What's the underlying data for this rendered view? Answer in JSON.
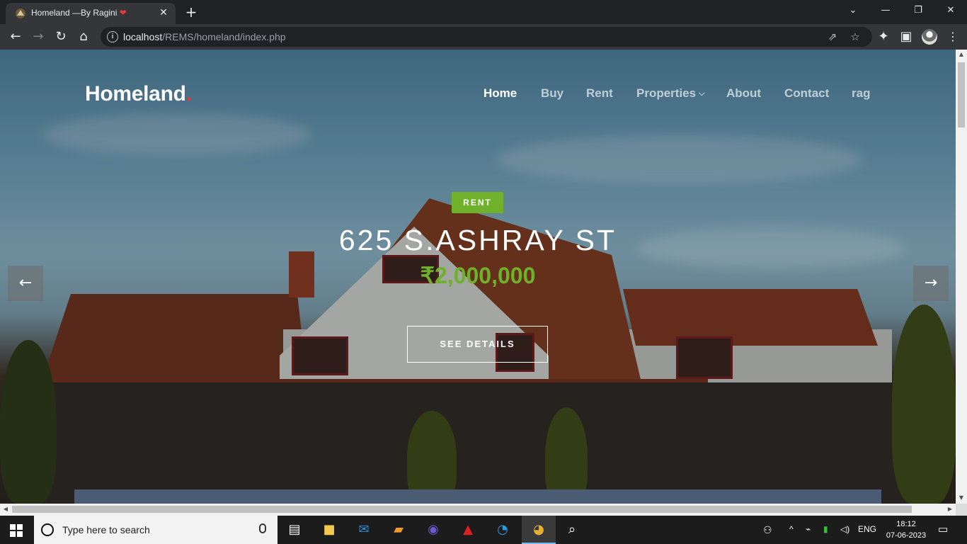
{
  "browser": {
    "tab_title": "Homeland —By Ragini",
    "tab_heart": "❤",
    "tab_close": "✕",
    "new_tab": "+",
    "url_host": "localhost",
    "url_path": "/REMS/homeland/index.php",
    "icons": {
      "back": "←",
      "forward": "→",
      "reload": "↻",
      "home": "⌂",
      "info": "i",
      "share": "⇗",
      "star": "☆",
      "extensions": "✦",
      "side_panel": "▣",
      "minimize": "—",
      "restore": "❐",
      "close": "✕",
      "tab_search": "⌄"
    }
  },
  "site": {
    "logo": "Homeland",
    "logo_dot": ".",
    "nav": [
      {
        "label": "Home",
        "active": true
      },
      {
        "label": "Buy"
      },
      {
        "label": "Rent"
      },
      {
        "label": "Properties",
        "dropdown": true
      },
      {
        "label": "About"
      },
      {
        "label": "Contact"
      },
      {
        "label": "rag"
      }
    ],
    "dropdown_caret": "⌵"
  },
  "slide": {
    "badge": "RENT",
    "title": "625 S.ASHRAY ST",
    "price": "₹2,000,000",
    "cta": "SEE DETAILS",
    "prev_arrow": "←",
    "next_arrow": "→",
    "accent_color": "#6fb12a"
  },
  "taskbar": {
    "search_placeholder": "Type here to search",
    "apps": [
      "task-view",
      "file-explorer",
      "mail",
      "sublime-text",
      "eclipse",
      "acrobat",
      "edge",
      "chrome",
      "search-app"
    ],
    "language": "ENG",
    "time": "18:12",
    "date": "07-06-2023"
  }
}
